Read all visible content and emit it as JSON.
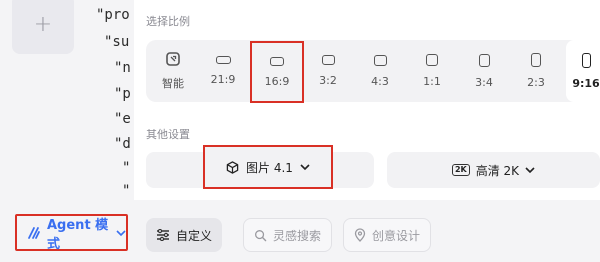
{
  "editor": {
    "add_icon": "plus-icon",
    "code_lines": [
      "\"pro",
      "\"su",
      "\"n",
      "\"p",
      "\"e",
      "\"d",
      "\"",
      "\""
    ]
  },
  "agent": {
    "label": "Agent 模式",
    "accent": "#3a6ff0"
  },
  "aspect": {
    "title": "选择比例",
    "options": [
      {
        "label": "智能",
        "icon": "smart-ratio-icon"
      },
      {
        "label": "21:9",
        "icon": "ratio-21-9-icon"
      },
      {
        "label": "16:9",
        "icon": "ratio-16-9-icon"
      },
      {
        "label": "3:2",
        "icon": "ratio-3-2-icon"
      },
      {
        "label": "4:3",
        "icon": "ratio-4-3-icon"
      },
      {
        "label": "1:1",
        "icon": "ratio-1-1-icon"
      },
      {
        "label": "3:4",
        "icon": "ratio-3-4-icon"
      },
      {
        "label": "2:3",
        "icon": "ratio-2-3-icon"
      },
      {
        "label": "9:16",
        "icon": "ratio-9-16-icon"
      }
    ]
  },
  "other": {
    "title": "其他设置",
    "model_label": "图片 4.1",
    "quality_badge": "2K",
    "quality_label": "高清 2K"
  },
  "toolbar": {
    "custom_label": "自定义",
    "inspiration_label": "灵感搜索",
    "creative_label": "创意设计"
  },
  "colors": {
    "highlight": "#d93025",
    "accent": "#3a6ff0"
  }
}
